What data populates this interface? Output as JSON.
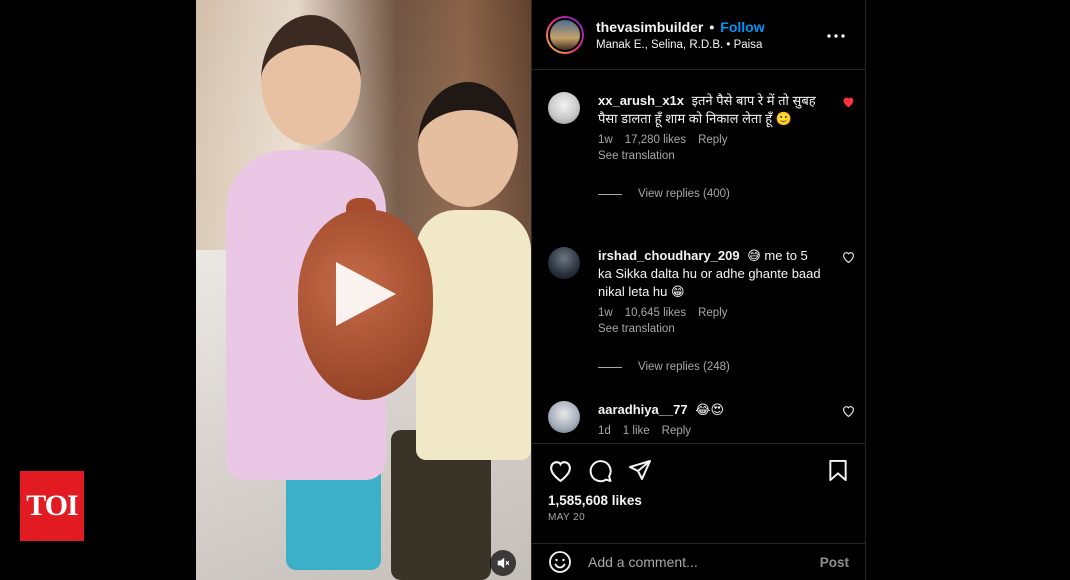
{
  "logo": {
    "text": "TOI"
  },
  "post": {
    "username": "thevasimbuilder",
    "separator": "•",
    "follow_label": "Follow",
    "audio_line": "Manak E., Selina, R.D.B. • Paisa",
    "more_icon": "more-horizontal-icon"
  },
  "comments": [
    {
      "user": "xx_arush_x1x",
      "text": "इतने पैसे बाप रे में तो सुबह पैसा डालता हूँ शाम को निकाल लेता हूँ 🙂",
      "age": "1w",
      "likes": "17,280 likes",
      "reply": "Reply",
      "translate": "See translation",
      "view_replies": "View replies (400)",
      "liked": true
    },
    {
      "user": "irshad_choudhary_209",
      "text": "😅 me to 5 ka Sikka dalta hu or adhe ghante baad nikal leta hu 😁",
      "age": "1w",
      "likes": "10,645 likes",
      "reply": "Reply",
      "translate": "See translation",
      "view_replies": "View replies (248)",
      "liked": false
    },
    {
      "user": "aaradhiya__77",
      "text": "😂😍",
      "age": "1d",
      "likes": "1 like",
      "reply": "Reply",
      "liked": false
    }
  ],
  "actions": {
    "likes": "1,585,608 likes",
    "date": "MAY 20"
  },
  "composer": {
    "placeholder": "Add a comment...",
    "post_label": "Post"
  },
  "colors": {
    "accent": "#0095f6",
    "like_red": "#ff3040",
    "toi_red": "#e21b22"
  }
}
